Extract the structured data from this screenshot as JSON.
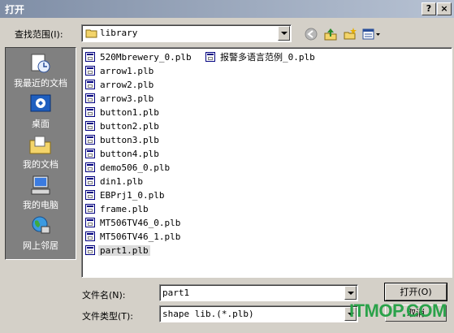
{
  "window": {
    "title": "打开",
    "help_label": "?",
    "close_label": "×"
  },
  "lookin": {
    "label": "查找范围(I):",
    "value": "library"
  },
  "places": [
    {
      "label": "我最近的文档",
      "icon": "recent-documents-icon"
    },
    {
      "label": "桌面",
      "icon": "desktop-icon"
    },
    {
      "label": "我的文档",
      "icon": "my-documents-icon"
    },
    {
      "label": "我的电脑",
      "icon": "my-computer-icon"
    },
    {
      "label": "网上邻居",
      "icon": "network-icon"
    }
  ],
  "files_col1": [
    "520Mbrewery_0.plb",
    "arrow1.plb",
    "arrow2.plb",
    "arrow3.plb",
    "button1.plb",
    "button2.plb",
    "button3.plb",
    "button4.plb",
    "demo506_0.plb",
    "din1.plb",
    "EBPrj1_0.plb",
    "frame.plb",
    "MT506TV46_0.plb",
    "MT506TV46_1.plb",
    "part1.plb"
  ],
  "files_col2": [
    "报警多语言范例_0.plb"
  ],
  "selected_file": "part1.plb",
  "filename": {
    "label": "文件名(N):",
    "value": "part1"
  },
  "filetype": {
    "label": "文件类型(T):",
    "value": "shape lib.(*.plb)"
  },
  "buttons": {
    "open": "打开(O)",
    "cancel": "取消"
  },
  "watermark": "ITMOP.COM",
  "colors": {
    "titlebar_start": "#7f8ea6",
    "titlebar_end": "#b7c2d3",
    "face": "#d4d0c8",
    "places_bg": "#808080",
    "watermark": "#2aa24a"
  }
}
